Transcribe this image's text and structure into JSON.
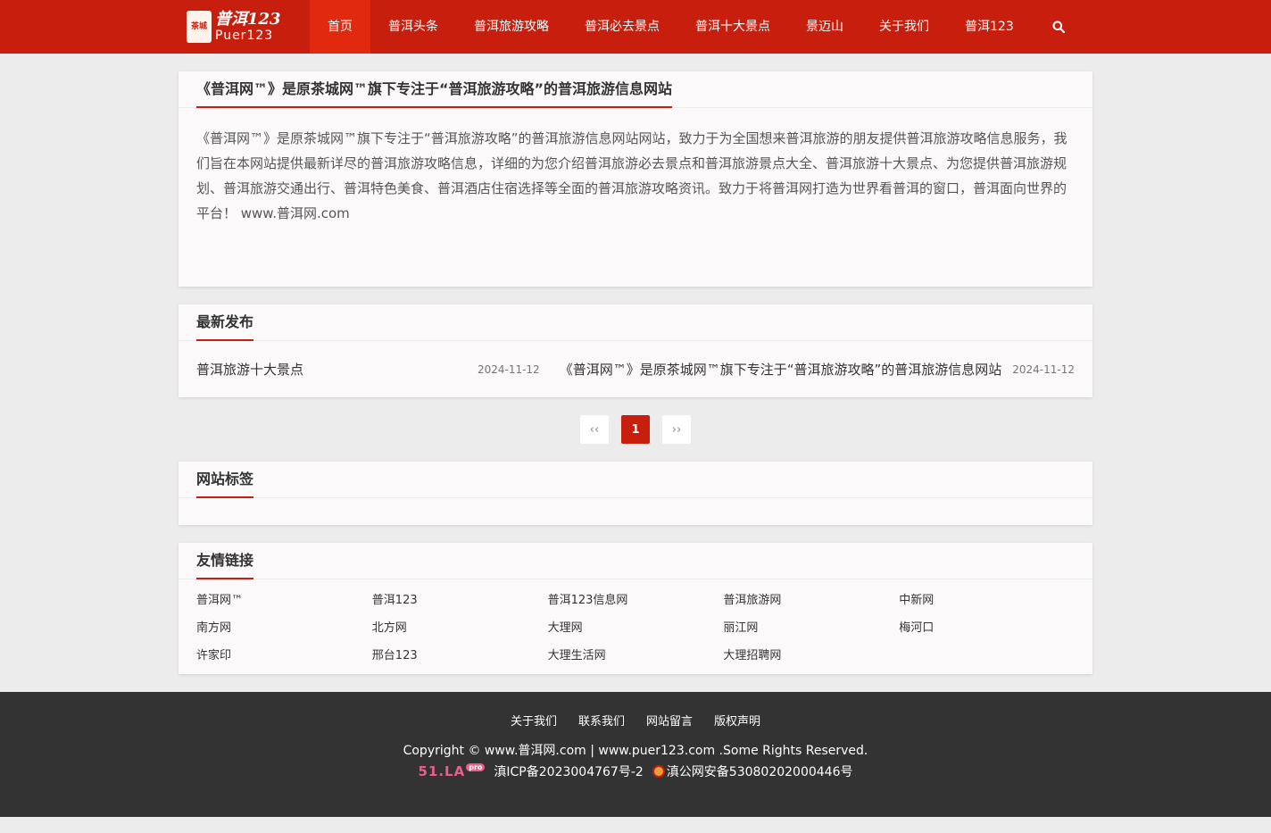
{
  "colors": {
    "brand": "#c81e0e",
    "nav_active": "#e0290f",
    "footer_bg": "#333333"
  },
  "header": {
    "logo": {
      "seal": "茶城",
      "title": "普洱123",
      "subtitle": "Puer123"
    },
    "nav": [
      {
        "label": "首页",
        "active": true
      },
      {
        "label": "普洱头条"
      },
      {
        "label": "普洱旅游攻略"
      },
      {
        "label": "普洱必去景点"
      },
      {
        "label": "普洱十大景点"
      },
      {
        "label": "景迈山"
      },
      {
        "label": "关于我们"
      },
      {
        "label": "普洱123"
      }
    ],
    "search_icon": "search-icon"
  },
  "intro": {
    "title": "《普洱网™》是原茶城网™旗下专注于“普洱旅游攻略”的普洱旅游信息网站",
    "body": "《普洱网™》是原茶城网™旗下专注于“普洱旅游攻略”的普洱旅游信息网站网站，致力于为全国想来普洱旅游的朋友提供普洱旅游攻略信息服务，我们旨在本网站提供最新详尽的普洱旅游攻略信息，详细的为您介绍普洱旅游必去景点和普洱旅游景点大全、普洱旅游十大景点、为您提供普洱旅游规划、普洱旅游交通出行、普洱特色美食、普洱酒店住宿选择等全面的普洱旅游攻略资讯。致力于将普洱网打造为世界看普洱的窗口，普洱面向世界的平台！ www.普洱网.com"
  },
  "latest": {
    "title": "最新发布",
    "items": [
      {
        "title": "普洱旅游十大景点",
        "date": "2024-11-12"
      },
      {
        "title": "《普洱网™》是原茶城网™旗下专注于“普洱旅游攻略”的普洱旅游信息网站",
        "date": "2024-11-12"
      }
    ]
  },
  "pager": {
    "prev": "‹‹",
    "current": "1",
    "next": "››"
  },
  "tags": {
    "title": "网站标签"
  },
  "links": {
    "title": "友情链接",
    "items": [
      "普洱网™",
      "普洱123",
      "普洱123信息网",
      "普洱旅游网",
      "中新网",
      "南方网",
      "北方网",
      "大理网",
      "丽江网",
      "梅河口",
      "许家印",
      "邢台123",
      "大理生活网",
      "大理招聘网"
    ]
  },
  "footer": {
    "links": [
      "关于我们",
      "联系我们",
      "网站留言",
      "版权声明"
    ],
    "copyright": "Copyright © www.普洱网.com | www.puer123.com .Some Rights Reserved.",
    "stat_badge": "51.LA",
    "stat_badge_pro": "pro",
    "icp": "滇ICP备2023004767号-2",
    "police": "滇公网安备53080202000446号"
  }
}
